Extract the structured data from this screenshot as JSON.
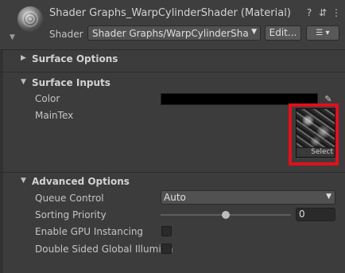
{
  "header": {
    "title": "Shader Graphs_WarpCylinderShader (Material)",
    "shader_label": "Shader",
    "shader_value": "Shader Graphs/WarpCylinderShader",
    "edit_button": "Edit...",
    "icons": [
      "help-icon",
      "preset-icon",
      "more-icon",
      "list-icon"
    ]
  },
  "sections": {
    "surface_options": "Surface Options",
    "surface_inputs": "Surface Inputs",
    "advanced_options": "Advanced Options"
  },
  "surface_inputs": {
    "color_label": "Color",
    "color_value": "#000000",
    "maintex_label": "MainTex",
    "select_label": "Select"
  },
  "advanced": {
    "queue_label": "Queue Control",
    "queue_value": "Auto",
    "sorting_label": "Sorting Priority",
    "sorting_value": "0",
    "sorting_slider_fraction": 0.5,
    "gpu_label": "Enable GPU Instancing",
    "gpu_checked": false,
    "double_sided_label": "Double Sided Global Illumina",
    "double_sided_checked": false
  }
}
